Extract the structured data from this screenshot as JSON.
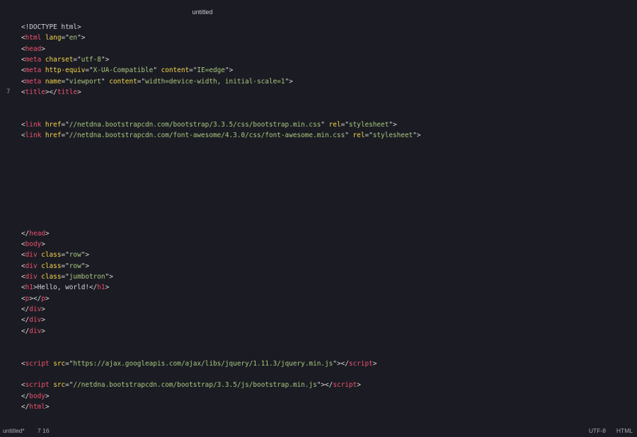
{
  "window": {
    "title": "untitled"
  },
  "gutter": {
    "current_line": "7"
  },
  "code_lines": [
    [
      {
        "t": "doctype",
        "v": "<!DOCTYPE html>"
      }
    ],
    [
      {
        "t": "punct",
        "v": "<"
      },
      {
        "t": "tag",
        "v": "html"
      },
      {
        "t": "text",
        "v": " "
      },
      {
        "t": "attr",
        "v": "lang"
      },
      {
        "t": "punct",
        "v": "=\""
      },
      {
        "t": "str",
        "v": "en"
      },
      {
        "t": "punct",
        "v": "\">"
      }
    ],
    [
      {
        "t": "punct",
        "v": "<"
      },
      {
        "t": "tag",
        "v": "head"
      },
      {
        "t": "punct",
        "v": ">"
      }
    ],
    [
      {
        "t": "punct",
        "v": "<"
      },
      {
        "t": "tag",
        "v": "meta"
      },
      {
        "t": "text",
        "v": " "
      },
      {
        "t": "attr",
        "v": "charset"
      },
      {
        "t": "punct",
        "v": "=\""
      },
      {
        "t": "str",
        "v": "utf-8"
      },
      {
        "t": "punct",
        "v": "\">"
      }
    ],
    [
      {
        "t": "punct",
        "v": "<"
      },
      {
        "t": "tag",
        "v": "meta"
      },
      {
        "t": "text",
        "v": " "
      },
      {
        "t": "attr",
        "v": "http-equiv"
      },
      {
        "t": "punct",
        "v": "=\""
      },
      {
        "t": "str",
        "v": "X-UA-Compatible"
      },
      {
        "t": "punct",
        "v": "\" "
      },
      {
        "t": "attr",
        "v": "content"
      },
      {
        "t": "punct",
        "v": "=\""
      },
      {
        "t": "str",
        "v": "IE=edge"
      },
      {
        "t": "punct",
        "v": "\">"
      }
    ],
    [
      {
        "t": "punct",
        "v": "<"
      },
      {
        "t": "tag",
        "v": "meta"
      },
      {
        "t": "text",
        "v": " "
      },
      {
        "t": "attr",
        "v": "name"
      },
      {
        "t": "punct",
        "v": "=\""
      },
      {
        "t": "str",
        "v": "viewport"
      },
      {
        "t": "punct",
        "v": "\" "
      },
      {
        "t": "attr",
        "v": "content"
      },
      {
        "t": "punct",
        "v": "=\""
      },
      {
        "t": "str",
        "v": "width=device-width, initial-scale=1"
      },
      {
        "t": "punct",
        "v": "\">"
      }
    ],
    [
      {
        "t": "punct",
        "v": "<"
      },
      {
        "t": "tag",
        "v": "title"
      },
      {
        "t": "punct",
        "v": "></"
      },
      {
        "t": "tag",
        "v": "title"
      },
      {
        "t": "punct",
        "v": ">"
      }
    ],
    [],
    [],
    [
      {
        "t": "punct",
        "v": "<"
      },
      {
        "t": "tag",
        "v": "link"
      },
      {
        "t": "text",
        "v": " "
      },
      {
        "t": "attr",
        "v": "href"
      },
      {
        "t": "punct",
        "v": "=\""
      },
      {
        "t": "str",
        "v": "//netdna.bootstrapcdn.com/bootstrap/3.3.5/css/bootstrap.min.css"
      },
      {
        "t": "punct",
        "v": "\" "
      },
      {
        "t": "attr",
        "v": "rel"
      },
      {
        "t": "punct",
        "v": "=\""
      },
      {
        "t": "str",
        "v": "stylesheet"
      },
      {
        "t": "punct",
        "v": "\">"
      }
    ],
    [
      {
        "t": "punct",
        "v": "<"
      },
      {
        "t": "tag",
        "v": "link"
      },
      {
        "t": "text",
        "v": " "
      },
      {
        "t": "attr",
        "v": "href"
      },
      {
        "t": "punct",
        "v": "=\""
      },
      {
        "t": "str",
        "v": "//netdna.bootstrapcdn.com/font-awesome/4.3.0/css/font-awesome.min.css"
      },
      {
        "t": "punct",
        "v": "\" "
      },
      {
        "t": "attr",
        "v": "rel"
      },
      {
        "t": "punct",
        "v": "=\""
      },
      {
        "t": "str",
        "v": "stylesheet"
      },
      {
        "t": "punct",
        "v": "\">"
      }
    ],
    [],
    [],
    [],
    [],
    [],
    [],
    [],
    [],
    [
      {
        "t": "punct",
        "v": "</"
      },
      {
        "t": "tag",
        "v": "head"
      },
      {
        "t": "punct",
        "v": ">"
      }
    ],
    [
      {
        "t": "punct",
        "v": "<"
      },
      {
        "t": "tag",
        "v": "body"
      },
      {
        "t": "punct",
        "v": ">"
      }
    ],
    [
      {
        "t": "punct",
        "v": "<"
      },
      {
        "t": "tag",
        "v": "div"
      },
      {
        "t": "text",
        "v": " "
      },
      {
        "t": "attr",
        "v": "class"
      },
      {
        "t": "punct",
        "v": "=\""
      },
      {
        "t": "str",
        "v": "row"
      },
      {
        "t": "punct",
        "v": "\">"
      }
    ],
    [
      {
        "t": "punct",
        "v": "<"
      },
      {
        "t": "tag",
        "v": "div"
      },
      {
        "t": "text",
        "v": " "
      },
      {
        "t": "attr",
        "v": "class"
      },
      {
        "t": "punct",
        "v": "=\""
      },
      {
        "t": "str",
        "v": "row"
      },
      {
        "t": "punct",
        "v": "\">"
      }
    ],
    [
      {
        "t": "punct",
        "v": "<"
      },
      {
        "t": "tag",
        "v": "div"
      },
      {
        "t": "text",
        "v": " "
      },
      {
        "t": "attr",
        "v": "class"
      },
      {
        "t": "punct",
        "v": "=\""
      },
      {
        "t": "str",
        "v": "jumbotron"
      },
      {
        "t": "punct",
        "v": "\">"
      }
    ],
    [
      {
        "t": "punct",
        "v": "<"
      },
      {
        "t": "tag",
        "v": "h1"
      },
      {
        "t": "punct",
        "v": ">"
      },
      {
        "t": "text",
        "v": "Hello, world!"
      },
      {
        "t": "punct",
        "v": "</"
      },
      {
        "t": "tag",
        "v": "h1"
      },
      {
        "t": "punct",
        "v": ">"
      }
    ],
    [
      {
        "t": "punct",
        "v": "<"
      },
      {
        "t": "tag",
        "v": "p"
      },
      {
        "t": "punct",
        "v": "></"
      },
      {
        "t": "tag",
        "v": "p"
      },
      {
        "t": "punct",
        "v": ">"
      }
    ],
    [
      {
        "t": "punct",
        "v": "</"
      },
      {
        "t": "tag",
        "v": "div"
      },
      {
        "t": "punct",
        "v": ">"
      }
    ],
    [
      {
        "t": "punct",
        "v": "</"
      },
      {
        "t": "tag",
        "v": "div"
      },
      {
        "t": "punct",
        "v": ">"
      }
    ],
    [
      {
        "t": "punct",
        "v": "</"
      },
      {
        "t": "tag",
        "v": "div"
      },
      {
        "t": "punct",
        "v": ">"
      }
    ],
    [],
    [],
    [
      {
        "t": "punct",
        "v": "<"
      },
      {
        "t": "tag",
        "v": "script"
      },
      {
        "t": "text",
        "v": " "
      },
      {
        "t": "attr",
        "v": "src"
      },
      {
        "t": "punct",
        "v": "=\""
      },
      {
        "t": "str",
        "v": "https://ajax.googleapis.com/ajax/libs/jquery/1.11.3/jquery.min.js"
      },
      {
        "t": "punct",
        "v": "\"></"
      },
      {
        "t": "tag",
        "v": "script"
      },
      {
        "t": "punct",
        "v": ">"
      }
    ],
    [],
    [
      {
        "t": "punct",
        "v": "<"
      },
      {
        "t": "tag",
        "v": "script"
      },
      {
        "t": "text",
        "v": " "
      },
      {
        "t": "attr",
        "v": "src"
      },
      {
        "t": "punct",
        "v": "=\""
      },
      {
        "t": "str",
        "v": "//netdna.bootstrapcdn.com/bootstrap/3.3.5/js/bootstrap.min.js"
      },
      {
        "t": "punct",
        "v": "\"></"
      },
      {
        "t": "tag",
        "v": "script"
      },
      {
        "t": "punct",
        "v": ">"
      }
    ],
    [
      {
        "t": "punct",
        "v": "</"
      },
      {
        "t": "tag",
        "v": "body"
      },
      {
        "t": "punct",
        "v": ">"
      }
    ],
    [
      {
        "t": "punct",
        "v": "</"
      },
      {
        "t": "tag",
        "v": "html"
      },
      {
        "t": "punct",
        "v": ">"
      }
    ]
  ],
  "statusbar": {
    "file": "untitled*",
    "position": "7 16",
    "encoding": "UTF-8",
    "syntax": "HTML"
  },
  "colors": {
    "background": "#1b1c23",
    "tag": "#f0506e",
    "attribute": "#f6d54a",
    "string": "#a9c77f",
    "text": "#d7d7db"
  }
}
